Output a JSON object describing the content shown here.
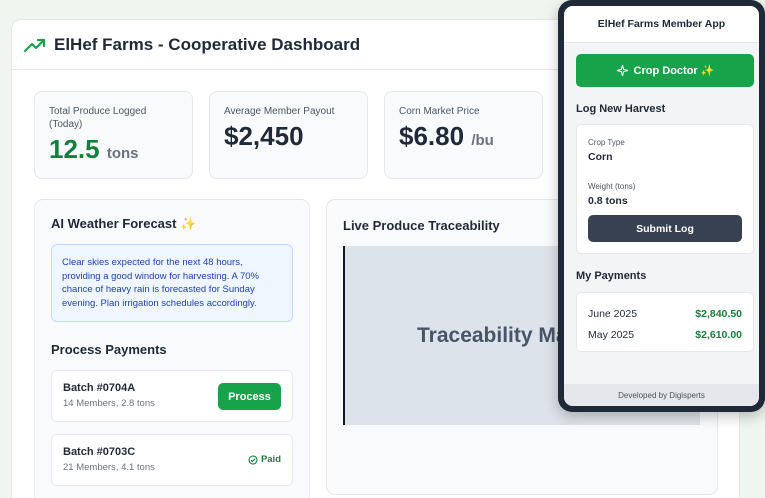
{
  "dashboard": {
    "title": "ElHef Farms - Cooperative Dashboard",
    "icon": "trending-up-icon"
  },
  "stats": [
    {
      "label": "Total Produce Logged (Today)",
      "value": "12.5",
      "unit": "tons"
    },
    {
      "label": "Average Member Payout",
      "value": "$2,450",
      "unit": ""
    },
    {
      "label": "Corn Market Price",
      "value": "$6.80",
      "unit": "/bu"
    }
  ],
  "weather": {
    "title": "AI Weather Forecast ✨",
    "text": "Clear skies expected for the next 48 hours, providing a good window for harvesting. A 70% chance of heavy rain is forecasted for Sunday evening. Plan irrigation schedules accordingly."
  },
  "payments": {
    "title": "Process Payments",
    "batches": [
      {
        "name": "Batch #0704A",
        "details": "14 Members, 2.8 tons",
        "action": "Process"
      },
      {
        "name": "Batch #0703C",
        "details": "21 Members, 4.1 tons",
        "status": "Paid"
      }
    ]
  },
  "traceability": {
    "title": "Live Produce Traceability",
    "placeholder": "Traceability Ma"
  },
  "phone": {
    "app_title": "ElHef Farms Member App",
    "crop_doctor": "Crop Doctor ✨",
    "log_title": "Log New Harvest",
    "crop_type_label": "Crop Type",
    "crop_type_value": "Corn",
    "weight_label": "Weight (tons)",
    "weight_value": "0.8 tons",
    "submit": "Submit Log",
    "payments_title": "My Payments",
    "payments": [
      {
        "month": "June 2025",
        "amount": "$2,840.50"
      },
      {
        "month": "May 2025",
        "amount": "$2,610.00"
      }
    ],
    "footer": "Developed by Digisperts"
  },
  "colors": {
    "accent": "#16a34a",
    "dark_button": "#374151",
    "info_bg": "#eff6ff"
  }
}
